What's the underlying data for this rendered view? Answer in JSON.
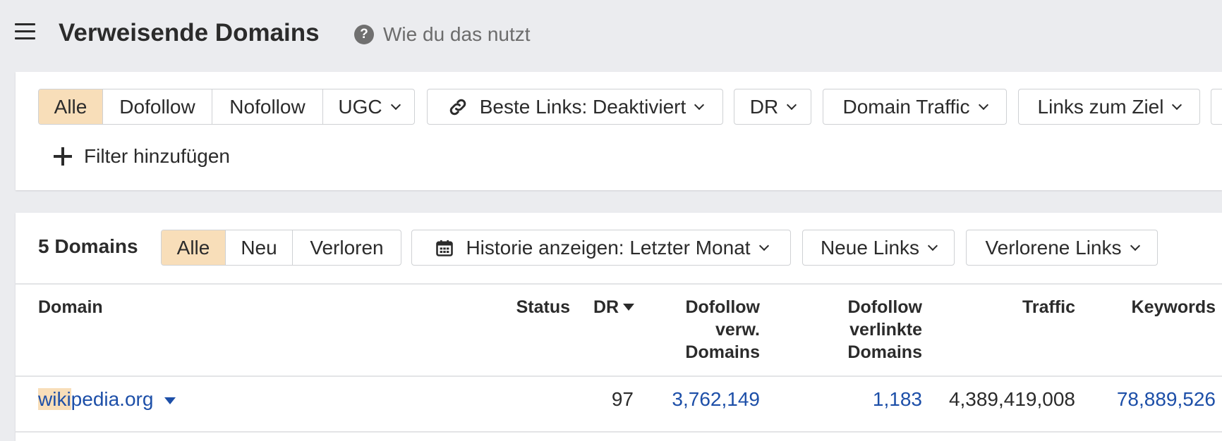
{
  "header": {
    "title": "Verweisende Domains",
    "help_label": "Wie du das nutzt"
  },
  "filters": {
    "link_type_tabs": [
      "Alle",
      "Dofollow",
      "Nofollow",
      "UGC"
    ],
    "best_links": "Beste Links: Deaktiviert",
    "dr": "DR",
    "domain_traffic": "Domain Traffic",
    "links_to_target": "Links zum Ziel",
    "add_filter": "Filter hinzufügen"
  },
  "results": {
    "count_label": "5 Domains",
    "tabs": [
      "Alle",
      "Neu",
      "Verloren"
    ],
    "history": "Historie anzeigen: Letzter Monat",
    "new_links": "Neue Links",
    "lost_links": "Verlorene Links"
  },
  "table": {
    "columns": {
      "domain": "Domain",
      "status": "Status",
      "dr": "DR",
      "dofollow_ref_domains": [
        "Dofollow",
        "verw.",
        "Domains"
      ],
      "dofollow_linked_domains": [
        "Dofollow",
        "verlinkte",
        "Domains"
      ],
      "traffic": "Traffic",
      "keywords": "Keywords"
    },
    "rows": [
      {
        "domain_highlight": "wiki",
        "domain_rest": "pedia.org",
        "status": "",
        "dr": "97",
        "dofollow_ref_domains": "3,762,149",
        "dofollow_linked_domains": "1,183",
        "traffic": "4,389,419,008",
        "keywords": "78,889,526"
      }
    ]
  },
  "colors": {
    "active_tab": "#f8deb9",
    "link": "#1d4fa8",
    "background": "#ebecef"
  }
}
